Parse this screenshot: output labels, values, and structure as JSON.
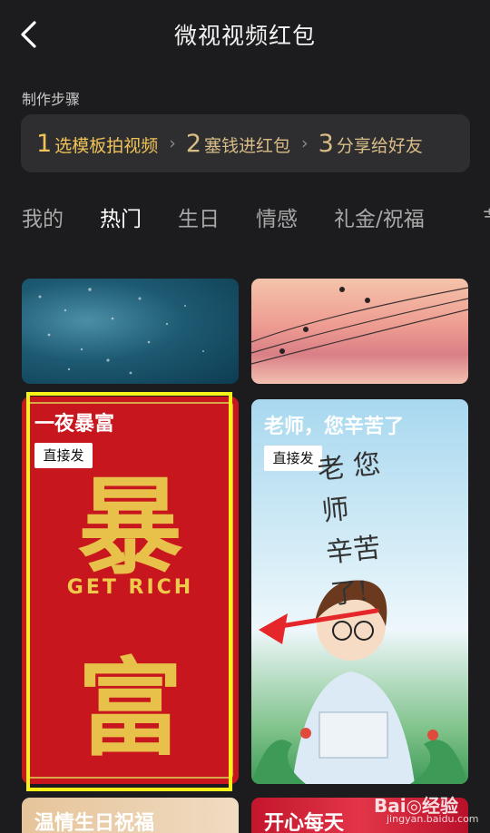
{
  "header": {
    "title": "微视视频红包"
  },
  "steps": {
    "label": "制作步骤",
    "items": [
      {
        "num": "1",
        "label": "选模板拍视频"
      },
      {
        "num": "2",
        "label": "塞钱进红包"
      },
      {
        "num": "3",
        "label": "分享给好友"
      }
    ]
  },
  "tabs": [
    "我的",
    "热门",
    "生日",
    "情感",
    "礼金/祝福",
    "节"
  ],
  "active_tab": "热门",
  "cards": {
    "rich": {
      "title": "一夜暴富",
      "badge": "直接发",
      "char_top": "暴",
      "latin": "GET RICH",
      "char_bottom": "富"
    },
    "teacher": {
      "title": "老师，您辛苦了",
      "badge": "直接发",
      "hand_line1": "老 您",
      "hand_line2": "师",
      "hand_line3": "辛苦",
      "hand_line4": "了!"
    },
    "bday": {
      "title": "温情生日祝福"
    },
    "happy": {
      "title": "开心每天"
    }
  },
  "watermark": {
    "brand": "Bai◎经验",
    "sub": "jingyan.baidu.com"
  },
  "colors": {
    "background": "#1c1c1e",
    "accent_gold": "#f0c357",
    "highlight": "#f6f21a",
    "arrow": "#e5262a"
  }
}
